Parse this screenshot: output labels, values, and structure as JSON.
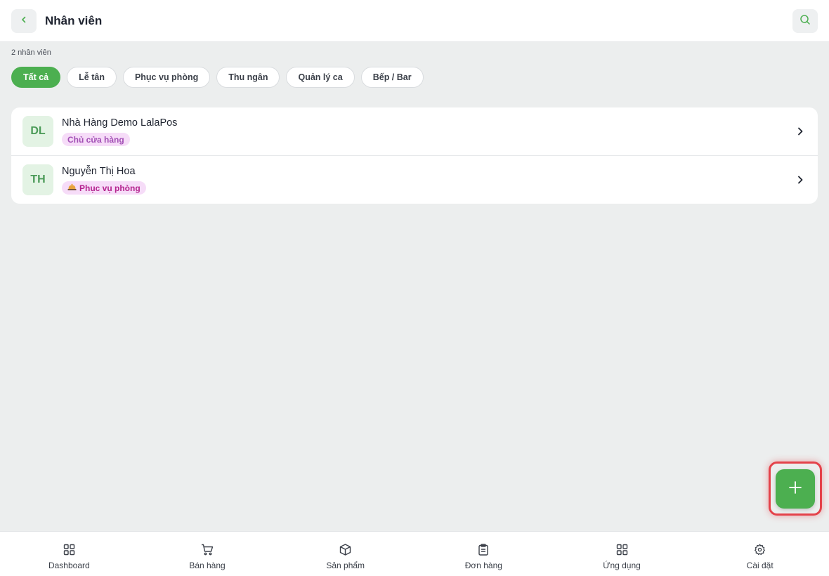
{
  "header": {
    "title": "Nhân viên",
    "back_icon": "chevron-left-icon",
    "search_icon": "search-icon"
  },
  "staff_count": "2 nhân viên",
  "filters": [
    {
      "label": "Tất cả",
      "active": true
    },
    {
      "label": "Lễ tân",
      "active": false
    },
    {
      "label": "Phục vụ phòng",
      "active": false
    },
    {
      "label": "Thu ngân",
      "active": false
    },
    {
      "label": "Quản lý ca",
      "active": false
    },
    {
      "label": "Bếp / Bar",
      "active": false
    }
  ],
  "staff": [
    {
      "initials": "DL",
      "name": "Nhà Hàng Demo LalaPos",
      "role": "Chủ cửa hàng",
      "role_icon": ""
    },
    {
      "initials": "TH",
      "name": "Nguyễn Thị Hoa",
      "role": "Phục vụ phòng",
      "role_icon": "bellhop-icon"
    }
  ],
  "fab": {
    "icon": "plus-icon"
  },
  "bottom_nav": [
    {
      "label": "Dashboard",
      "icon": "grid-icon"
    },
    {
      "label": "Bán hàng",
      "icon": "cart-icon"
    },
    {
      "label": "Sản phẩm",
      "icon": "box-icon"
    },
    {
      "label": "Đơn hàng",
      "icon": "clipboard-icon"
    },
    {
      "label": "Ứng dụng",
      "icon": "apps-icon"
    },
    {
      "label": "Cài đặt",
      "icon": "gear-icon"
    }
  ],
  "colors": {
    "accent": "#4caf50",
    "highlight": "#e4424a",
    "badge_bg": "#f6dcf8",
    "avatar_bg": "#e3f3e4"
  }
}
